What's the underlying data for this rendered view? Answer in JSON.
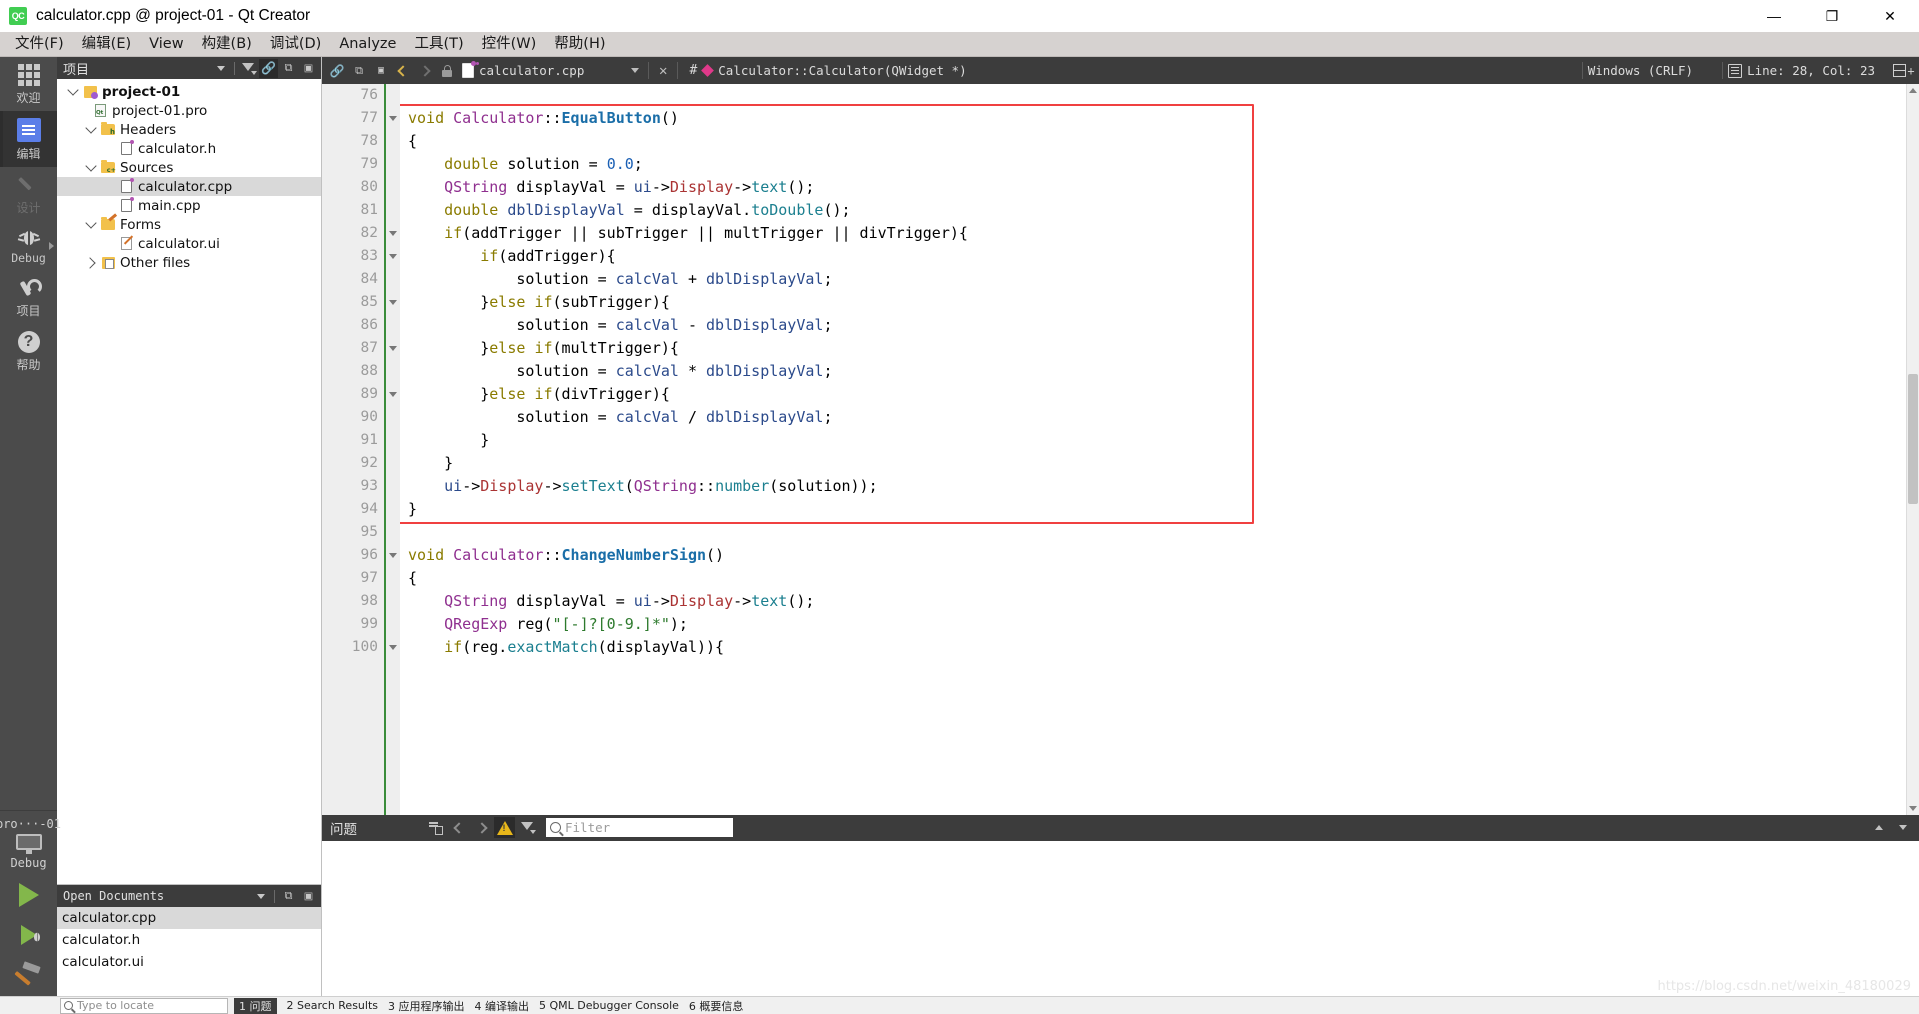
{
  "window": {
    "title": "calculator.cpp @ project-01 - Qt Creator",
    "logo_text": "QC",
    "minimize": "—",
    "maximize": "❐",
    "close": "✕"
  },
  "menubar": {
    "items": [
      {
        "label": "文件(F)",
        "name": "menu-file"
      },
      {
        "label": "编辑(E)",
        "name": "menu-edit"
      },
      {
        "label": "View",
        "name": "menu-view"
      },
      {
        "label": "构建(B)",
        "name": "menu-build"
      },
      {
        "label": "调试(D)",
        "name": "menu-debug"
      },
      {
        "label": "Analyze",
        "name": "menu-analyze"
      },
      {
        "label": "工具(T)",
        "name": "menu-tools"
      },
      {
        "label": "控件(W)",
        "name": "menu-window"
      },
      {
        "label": "帮助(H)",
        "name": "menu-help"
      }
    ]
  },
  "modebar": {
    "modes": [
      {
        "label": "欢迎",
        "icon": "grid-icon",
        "active": false,
        "dim": false
      },
      {
        "label": "编辑",
        "icon": "edit-icon",
        "active": true,
        "dim": false
      },
      {
        "label": "设计",
        "icon": "pencil-icon",
        "active": false,
        "dim": true
      },
      {
        "label": "Debug",
        "icon": "bug-icon",
        "active": false,
        "dim": false
      },
      {
        "label": "项目",
        "icon": "wrench-icon",
        "active": false,
        "dim": false
      },
      {
        "label": "帮助",
        "icon": "help-icon",
        "active": false,
        "dim": false
      }
    ],
    "kit": {
      "project_name": "pro···-01",
      "build_config": "Debug",
      "icon": "monitor-icon"
    },
    "run_label": "run-button",
    "debug_label": "start-debugging-button",
    "build_label": "build-button"
  },
  "sidebar": {
    "projects_panel": {
      "title": "项目",
      "tools": [
        "chevron-down-icon",
        "filter-icon",
        "link-icon",
        "split-icon",
        "minimize-icon"
      ]
    },
    "tree": [
      {
        "label": "project-01",
        "depth": 0,
        "expander": "down",
        "icon": "project-gear-icon",
        "bold": true,
        "selected": false
      },
      {
        "label": "project-01.pro",
        "depth": 1,
        "expander": "none",
        "icon": "pro-file-icon",
        "bold": false,
        "selected": false
      },
      {
        "label": "Headers",
        "depth": 1,
        "expander": "down",
        "icon": "folder-h-icon",
        "bold": false,
        "selected": false
      },
      {
        "label": "calculator.h",
        "depth": 2,
        "expander": "none",
        "icon": "header-file-icon",
        "bold": false,
        "selected": false
      },
      {
        "label": "Sources",
        "depth": 1,
        "expander": "down",
        "icon": "folder-cpp-icon",
        "bold": false,
        "selected": false
      },
      {
        "label": "calculator.cpp",
        "depth": 2,
        "expander": "none",
        "icon": "source-file-icon",
        "bold": false,
        "selected": true
      },
      {
        "label": "main.cpp",
        "depth": 2,
        "expander": "none",
        "icon": "source-file-icon",
        "bold": false,
        "selected": false
      },
      {
        "label": "Forms",
        "depth": 1,
        "expander": "down",
        "icon": "folder-form-icon",
        "bold": false,
        "selected": false
      },
      {
        "label": "calculator.ui",
        "depth": 2,
        "expander": "none",
        "icon": "ui-file-icon",
        "bold": false,
        "selected": false
      },
      {
        "label": "Other files",
        "depth": 1,
        "expander": "right",
        "icon": "other-files-icon",
        "bold": false,
        "selected": false
      }
    ],
    "open_documents": {
      "title": "Open Documents",
      "items": [
        {
          "label": "calculator.cpp",
          "selected": true
        },
        {
          "label": "calculator.h",
          "selected": false
        },
        {
          "label": "calculator.ui",
          "selected": false
        }
      ]
    }
  },
  "editor_toolbar": {
    "back": "chevron-left-icon",
    "forward": "chevron-right-icon",
    "lock": "unlock-icon",
    "file_name": "calculator.cpp",
    "close_label": "✕",
    "hash": "#",
    "symbol": "Calculator::Calculator(QWidget *)",
    "line_ending": "Windows (CRLF)",
    "cursor_position": "Line: 28, Col: 23",
    "split_label": "split-editor-button"
  },
  "code": {
    "first_line": 76,
    "lines": [
      {
        "n": 76,
        "fold": false,
        "tokens": []
      },
      {
        "n": 77,
        "fold": true,
        "tokens": [
          {
            "t": "void",
            "c": "k"
          },
          {
            "t": " ",
            "c": "op"
          },
          {
            "t": "Calculator",
            "c": "ty"
          },
          {
            "t": "::",
            "c": "op"
          },
          {
            "t": "EqualButton",
            "c": "fn"
          },
          {
            "t": "()",
            "c": "op"
          }
        ]
      },
      {
        "n": 78,
        "fold": false,
        "tokens": [
          {
            "t": "{",
            "c": "op"
          }
        ]
      },
      {
        "n": 79,
        "fold": false,
        "tokens": [
          {
            "t": "    ",
            "c": "op"
          },
          {
            "t": "double",
            "c": "k"
          },
          {
            "t": " solution = ",
            "c": "op"
          },
          {
            "t": "0.0",
            "c": "num"
          },
          {
            "t": ";",
            "c": "op"
          }
        ]
      },
      {
        "n": 80,
        "fold": false,
        "tokens": [
          {
            "t": "    ",
            "c": "op"
          },
          {
            "t": "QString",
            "c": "ty"
          },
          {
            "t": " displayVal = ",
            "c": "op"
          },
          {
            "t": "ui",
            "c": "id"
          },
          {
            "t": "->",
            "c": "op"
          },
          {
            "t": "Display",
            "c": "mb"
          },
          {
            "t": "->",
            "c": "op"
          },
          {
            "t": "text",
            "c": "mth"
          },
          {
            "t": "();",
            "c": "op"
          }
        ]
      },
      {
        "n": 81,
        "fold": false,
        "tokens": [
          {
            "t": "    ",
            "c": "op"
          },
          {
            "t": "double",
            "c": "k"
          },
          {
            "t": " ",
            "c": "op"
          },
          {
            "t": "dblDisplayVal",
            "c": "id"
          },
          {
            "t": " = displayVal.",
            "c": "op"
          },
          {
            "t": "toDouble",
            "c": "mth"
          },
          {
            "t": "();",
            "c": "op"
          }
        ]
      },
      {
        "n": 82,
        "fold": true,
        "tokens": [
          {
            "t": "    ",
            "c": "op"
          },
          {
            "t": "if",
            "c": "k"
          },
          {
            "t": "(addTrigger || subTrigger || multTrigger || divTrigger){",
            "c": "op"
          }
        ]
      },
      {
        "n": 83,
        "fold": true,
        "tokens": [
          {
            "t": "        ",
            "c": "op"
          },
          {
            "t": "if",
            "c": "k"
          },
          {
            "t": "(addTrigger){",
            "c": "op"
          }
        ]
      },
      {
        "n": 84,
        "fold": false,
        "tokens": [
          {
            "t": "            solution = ",
            "c": "op"
          },
          {
            "t": "calcVal",
            "c": "id"
          },
          {
            "t": " + ",
            "c": "op"
          },
          {
            "t": "dblDisplayVal",
            "c": "id"
          },
          {
            "t": ";",
            "c": "op"
          }
        ]
      },
      {
        "n": 85,
        "fold": true,
        "tokens": [
          {
            "t": "        }",
            "c": "op"
          },
          {
            "t": "else",
            "c": "k"
          },
          {
            "t": " ",
            "c": "op"
          },
          {
            "t": "if",
            "c": "k"
          },
          {
            "t": "(subTrigger){",
            "c": "op"
          }
        ]
      },
      {
        "n": 86,
        "fold": false,
        "tokens": [
          {
            "t": "            solution = ",
            "c": "op"
          },
          {
            "t": "calcVal",
            "c": "id"
          },
          {
            "t": " - ",
            "c": "op"
          },
          {
            "t": "dblDisplayVal",
            "c": "id"
          },
          {
            "t": ";",
            "c": "op"
          }
        ]
      },
      {
        "n": 87,
        "fold": true,
        "tokens": [
          {
            "t": "        }",
            "c": "op"
          },
          {
            "t": "else",
            "c": "k"
          },
          {
            "t": " ",
            "c": "op"
          },
          {
            "t": "if",
            "c": "k"
          },
          {
            "t": "(multTrigger){",
            "c": "op"
          }
        ]
      },
      {
        "n": 88,
        "fold": false,
        "tokens": [
          {
            "t": "            solution = ",
            "c": "op"
          },
          {
            "t": "calcVal",
            "c": "id"
          },
          {
            "t": " * ",
            "c": "op"
          },
          {
            "t": "dblDisplayVal",
            "c": "id"
          },
          {
            "t": ";",
            "c": "op"
          }
        ]
      },
      {
        "n": 89,
        "fold": true,
        "tokens": [
          {
            "t": "        }",
            "c": "op"
          },
          {
            "t": "else",
            "c": "k"
          },
          {
            "t": " ",
            "c": "op"
          },
          {
            "t": "if",
            "c": "k"
          },
          {
            "t": "(divTrigger){",
            "c": "op"
          }
        ]
      },
      {
        "n": 90,
        "fold": false,
        "tokens": [
          {
            "t": "            solution = ",
            "c": "op"
          },
          {
            "t": "calcVal",
            "c": "id"
          },
          {
            "t": " / ",
            "c": "op"
          },
          {
            "t": "dblDisplayVal",
            "c": "id"
          },
          {
            "t": ";",
            "c": "op"
          }
        ]
      },
      {
        "n": 91,
        "fold": false,
        "tokens": [
          {
            "t": "        }",
            "c": "op"
          }
        ]
      },
      {
        "n": 92,
        "fold": false,
        "tokens": [
          {
            "t": "    }",
            "c": "op"
          }
        ]
      },
      {
        "n": 93,
        "fold": false,
        "tokens": [
          {
            "t": "    ",
            "c": "op"
          },
          {
            "t": "ui",
            "c": "id"
          },
          {
            "t": "->",
            "c": "op"
          },
          {
            "t": "Display",
            "c": "mb"
          },
          {
            "t": "->",
            "c": "op"
          },
          {
            "t": "setText",
            "c": "mth"
          },
          {
            "t": "(",
            "c": "op"
          },
          {
            "t": "QString",
            "c": "ty"
          },
          {
            "t": "::",
            "c": "op"
          },
          {
            "t": "number",
            "c": "mth"
          },
          {
            "t": "(solution));",
            "c": "op"
          }
        ]
      },
      {
        "n": 94,
        "fold": false,
        "tokens": [
          {
            "t": "}",
            "c": "op"
          }
        ]
      },
      {
        "n": 95,
        "fold": false,
        "tokens": []
      },
      {
        "n": 96,
        "fold": true,
        "tokens": [
          {
            "t": "void",
            "c": "k"
          },
          {
            "t": " ",
            "c": "op"
          },
          {
            "t": "Calculator",
            "c": "ty"
          },
          {
            "t": "::",
            "c": "op"
          },
          {
            "t": "ChangeNumberSign",
            "c": "fn"
          },
          {
            "t": "()",
            "c": "op"
          }
        ]
      },
      {
        "n": 97,
        "fold": false,
        "tokens": [
          {
            "t": "{",
            "c": "op"
          }
        ]
      },
      {
        "n": 98,
        "fold": false,
        "tokens": [
          {
            "t": "    ",
            "c": "op"
          },
          {
            "t": "QString",
            "c": "ty"
          },
          {
            "t": " displayVal = ",
            "c": "op"
          },
          {
            "t": "ui",
            "c": "id"
          },
          {
            "t": "->",
            "c": "op"
          },
          {
            "t": "Display",
            "c": "mb"
          },
          {
            "t": "->",
            "c": "op"
          },
          {
            "t": "text",
            "c": "mth"
          },
          {
            "t": "();",
            "c": "op"
          }
        ]
      },
      {
        "n": 99,
        "fold": false,
        "tokens": [
          {
            "t": "    ",
            "c": "op"
          },
          {
            "t": "QRegExp",
            "c": "ty"
          },
          {
            "t": " reg(",
            "c": "op"
          },
          {
            "t": "\"[-]?[0-9.]*\"",
            "c": "str"
          },
          {
            "t": ");",
            "c": "op"
          }
        ]
      },
      {
        "n": 100,
        "fold": true,
        "tokens": [
          {
            "t": "    ",
            "c": "op"
          },
          {
            "t": "if",
            "c": "k"
          },
          {
            "t": "(reg.",
            "c": "op"
          },
          {
            "t": "exactMatch",
            "c": "mth"
          },
          {
            "t": "(displayVal)){",
            "c": "op"
          }
        ]
      }
    ],
    "highlight_box": {
      "color": "#f04040",
      "from_line": 77,
      "to_line": 94
    }
  },
  "issues_pane": {
    "title": "问题",
    "filter_placeholder": "Filter",
    "warning_icon": "warning-icon",
    "clear_icon": "clear-icon",
    "prev_icon": "chevron-left-icon",
    "next_icon": "chevron-right-icon",
    "filter_icon": "filter-icon",
    "maximize_icon": "chevron-up-icon",
    "close_icon": "chevron-down-icon"
  },
  "watermark": "https://blog.csdn.net/weixin_48180029",
  "status_strip": {
    "locator_placeholder": "Type to locate",
    "chip": "1 问题",
    "items": [
      "2 Search Results",
      "3 应用程序输出",
      "4 编译输出",
      "5 QML Debugger Console",
      "6 概要信息"
    ]
  },
  "colors": {
    "accent_green": "#41cd52",
    "highlight_red": "#f04040",
    "panel_dark": "#3c3c3c",
    "modebar_dark": "#4b4b4b",
    "menubar": "#d6d2d0",
    "selection": "#d9d9d9",
    "fold_marker_green": "#3a8c3a"
  }
}
